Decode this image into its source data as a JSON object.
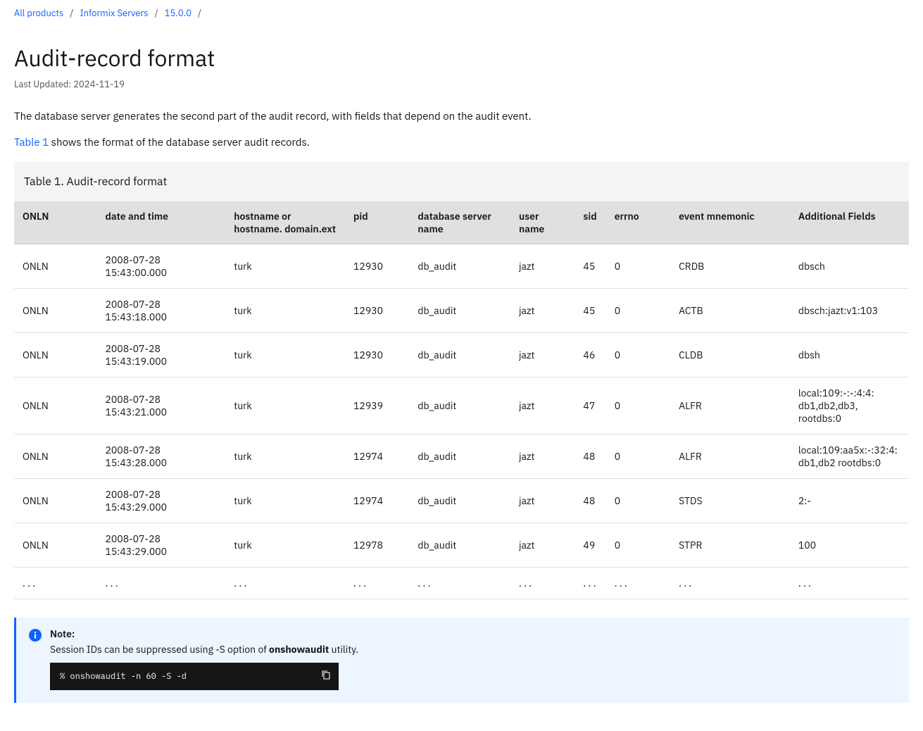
{
  "breadcrumb": {
    "items": [
      "All products",
      "Informix Servers",
      "15.0.0"
    ]
  },
  "page": {
    "title": "Audit-record format",
    "last_updated_label": "Last Updated: 2024-11-19",
    "intro1": "The database server generates the second part of the audit record, with fields that depend on the audit event.",
    "intro2_link": "Table 1",
    "intro2_rest": " shows the format of the database server audit records."
  },
  "table": {
    "caption": "Table 1. Audit-record format",
    "headers": [
      "ONLN",
      "date and time",
      "hostname or hostname. domain.ext",
      "pid",
      "database server name",
      "user name",
      "sid",
      "errno",
      "event mnemonic",
      "Additional Fields"
    ],
    "rows": [
      [
        "ONLN",
        "2008-07-28 15:43:00.000",
        "turk",
        "12930",
        "db_audit",
        "jazt",
        "45",
        "0",
        "CRDB",
        "dbsch"
      ],
      [
        "ONLN",
        "2008-07-28 15:43:18.000",
        "turk",
        "12930",
        "db_audit",
        "jazt",
        "45",
        "0",
        "ACTB",
        "dbsch:jazt:v1:103"
      ],
      [
        "ONLN",
        "2008-07-28 15:43:19.000",
        "turk",
        "12930",
        "db_audit",
        "jazt",
        "46",
        "0",
        "CLDB",
        "dbsh"
      ],
      [
        "ONLN",
        "2008-07-28 15:43:21.000",
        "turk",
        "12939",
        "db_audit",
        "jazt",
        "47",
        "0",
        "ALFR",
        "local:109:-:-:4:4: db1,db2,db3, rootdbs:0"
      ],
      [
        "ONLN",
        "2008-07-28 15:43:28.000",
        "turk",
        "12974",
        "db_audit",
        "jazt",
        "48",
        "0",
        "ALFR",
        "local:109:aa5x:-:32:4: db1,db2 rootdbs:0"
      ],
      [
        "ONLN",
        "2008-07-28 15:43:29.000",
        "turk",
        "12974",
        "db_audit",
        "jazt",
        "48",
        "0",
        "STDS",
        "2:-"
      ],
      [
        "ONLN",
        "2008-07-28 15:43:29.000",
        "turk",
        "12978",
        "db_audit",
        "jazt",
        "49",
        "0",
        "STPR",
        "100"
      ],
      [
        ". . .",
        ". . .",
        ". . .",
        ". . .",
        ". . .",
        ". . .",
        ". . .",
        ". . .",
        ". . .",
        ". . ."
      ]
    ]
  },
  "note": {
    "label": "Note:",
    "text_prefix": "Session IDs can be suppressed using -S option of ",
    "text_code": "onshowaudit",
    "text_suffix": " utility.",
    "code": "% onshowaudit -n 60 -S -d"
  }
}
